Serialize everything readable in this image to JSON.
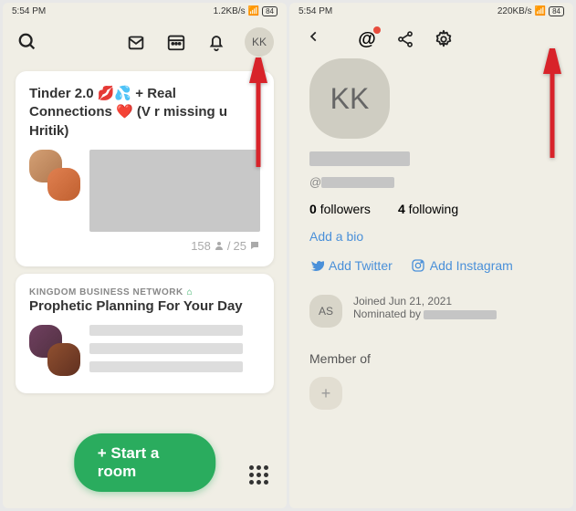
{
  "status": {
    "time": "5:54 PM",
    "net_left": "1.2KB/s",
    "net_right": "220KB/s",
    "battery": "84"
  },
  "left": {
    "avatar": "KK",
    "card1": {
      "title": "Tinder 2.0 💋💦 + Real Connections ❤️ (V r missing u Hritik)",
      "count_users": "158",
      "count_chat": "25"
    },
    "card2": {
      "club": "KINGDOM BUSINESS NETWORK",
      "title": "Prophetic Planning For Your Day"
    },
    "start_room": "+ Start a room"
  },
  "right": {
    "avatar": "KK",
    "handle_prefix": "@",
    "followers_n": "0",
    "followers_l": "followers",
    "following_n": "4",
    "following_l": "following",
    "add_bio": "Add a bio",
    "add_twitter": "Add Twitter",
    "add_instagram": "Add Instagram",
    "nominator_av": "AS",
    "joined": "Joined Jun 21, 2021",
    "nominated": "Nominated by",
    "member_of": "Member of",
    "plus": "+"
  }
}
